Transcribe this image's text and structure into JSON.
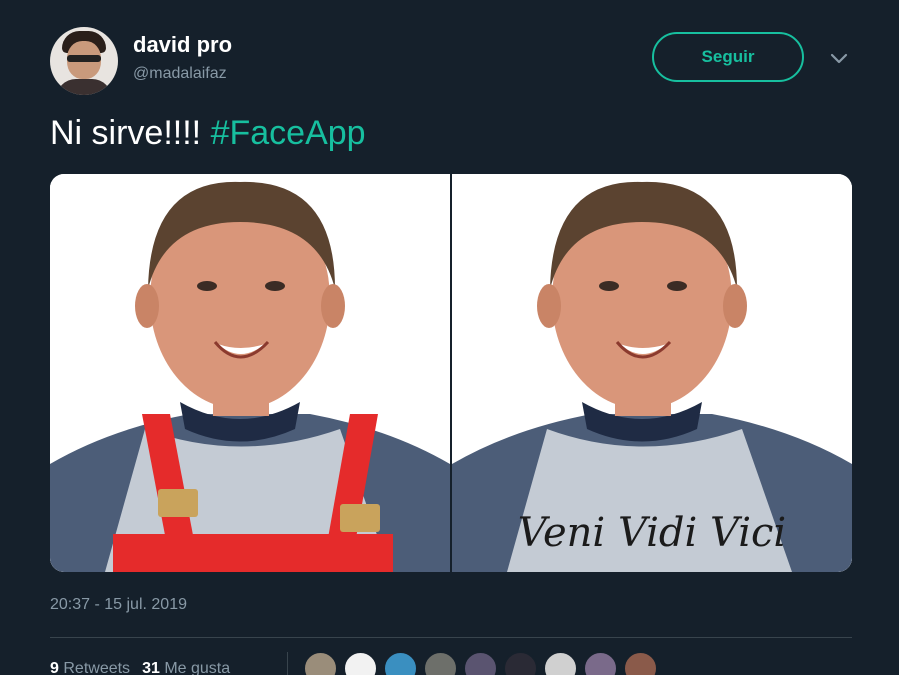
{
  "user": {
    "name": "david pro",
    "handle": "@madalaifaz"
  },
  "follow_label": "Seguir",
  "tweet": {
    "text": "Ni sirve!!!!",
    "hashtag": "#FaceApp"
  },
  "media": {
    "shirt_text": "Veni Vidi Vici"
  },
  "timestamp": "20:37 - 15 jul. 2019",
  "stats": {
    "retweets_count": "9",
    "retweets_label": "Retweets",
    "likes_count": "31",
    "likes_label": "Me gusta"
  },
  "colors": {
    "background": "#15202b",
    "accent": "#17bf9f",
    "secondary_text": "#8899a6",
    "divider": "#38444d"
  }
}
